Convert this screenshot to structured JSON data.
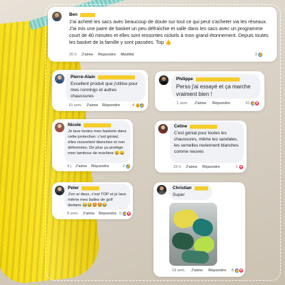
{
  "comments": [
    {
      "name": "Ben",
      "text": "J'ai acheté les sacs avec beaucoup de doute sur tout ce qui peut s'acheter via les réseaux. J'ai mis une paire de basket un peu défraîchie et salle dans les sacs avec un programme court de 40 minutes et elles sont ressorties nickels à mon grand étonnement. Depuis toutes les basket de la famille y sont passées. Top 👍",
      "time": "20 h",
      "like": "J'aime",
      "reply": "Répondre",
      "edited": "Modifié",
      "reactions": "3"
    },
    {
      "name": "Pierre-Alain",
      "text": "Excellent produit que j'utilise pour mes runnings et autres chaussures",
      "time": "10 sem.",
      "like": "J'aime",
      "reply": "Répondre",
      "reactions": "4"
    },
    {
      "name": "Philippe",
      "text": "Perso j'ai essayé et ça marche vraiment bien !",
      "time": "1 sem.",
      "like": "J'aime",
      "reply": "Répondre",
      "reactions": "10"
    },
    {
      "name": "Nicole",
      "text": "Je lave toutes mes baskets dans cette protection: c'est génial, elles ressortent blanches et non déformées. De plus ça protège mon tambour de machine 😀😀",
      "time": "4 j",
      "like": "J'aime",
      "reply": "Répondre",
      "reactions": "2"
    },
    {
      "name": "Celine",
      "text": "C'est génial pour toutes les chaussures, même les sandales, les semelles reviennent blanches comme neuves",
      "time": "23 h",
      "like": "J'aime",
      "reply": "Répondre",
      "reactions": "1"
    },
    {
      "name": "Peter",
      "text": "J'en ai deux, c'est TOP et je lave même mes balles de golf dedans 😂😂🤩🤩😂",
      "time": "8 sem.",
      "like": "J'aime",
      "reply": "Répondre",
      "reactions": "5"
    },
    {
      "name": "Christian",
      "text": "Super",
      "time": "19 sem.",
      "like": "J'aime",
      "reply": "Répondre",
      "reactions": "8"
    }
  ],
  "colors": {
    "highlight": "#f5cd2b",
    "like": "#1877f2",
    "love": "#f33e58",
    "bubble": "#f0f2f5"
  }
}
